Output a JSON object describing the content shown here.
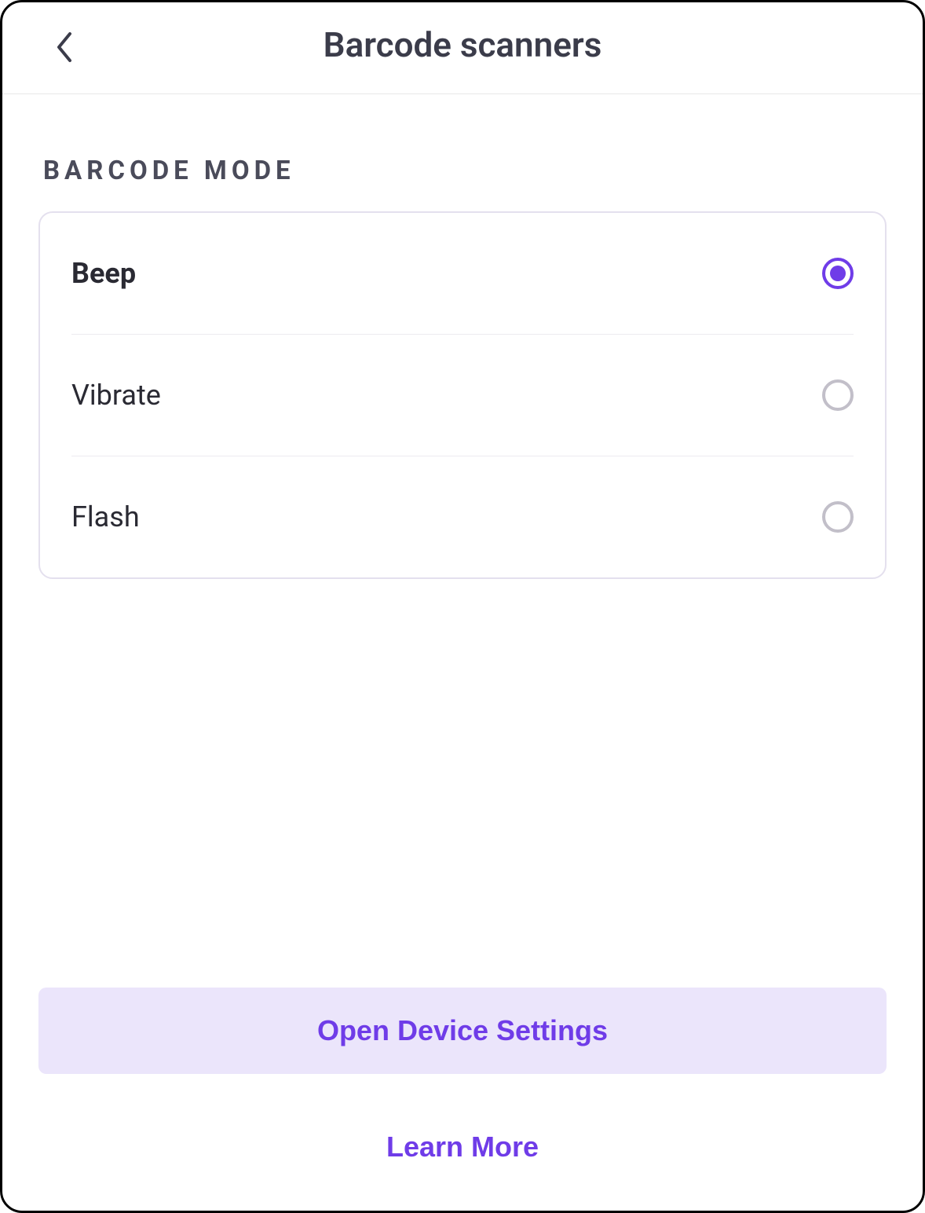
{
  "header": {
    "title": "Barcode scanners"
  },
  "section": {
    "label": "BARCODE MODE",
    "options": [
      {
        "label": "Beep",
        "selected": true
      },
      {
        "label": "Vibrate",
        "selected": false
      },
      {
        "label": "Flash",
        "selected": false
      }
    ]
  },
  "footer": {
    "primary_button": "Open Device Settings",
    "link": "Learn More"
  }
}
